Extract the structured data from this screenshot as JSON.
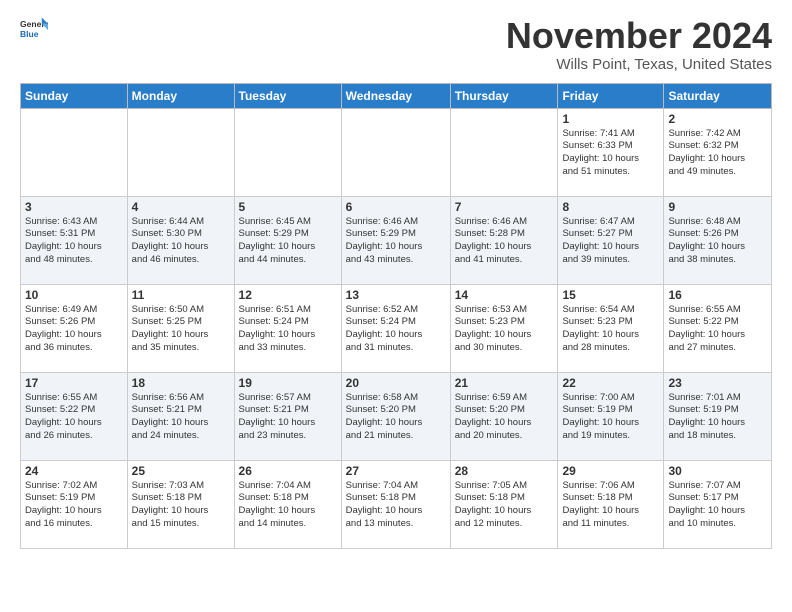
{
  "logo": {
    "general": "General",
    "blue": "Blue"
  },
  "header": {
    "month": "November 2024",
    "location": "Wills Point, Texas, United States"
  },
  "weekdays": [
    "Sunday",
    "Monday",
    "Tuesday",
    "Wednesday",
    "Thursday",
    "Friday",
    "Saturday"
  ],
  "weeks": [
    [
      {
        "day": "",
        "content": ""
      },
      {
        "day": "",
        "content": ""
      },
      {
        "day": "",
        "content": ""
      },
      {
        "day": "",
        "content": ""
      },
      {
        "day": "",
        "content": ""
      },
      {
        "day": "1",
        "content": "Sunrise: 7:41 AM\nSunset: 6:33 PM\nDaylight: 10 hours\nand 51 minutes."
      },
      {
        "day": "2",
        "content": "Sunrise: 7:42 AM\nSunset: 6:32 PM\nDaylight: 10 hours\nand 49 minutes."
      }
    ],
    [
      {
        "day": "3",
        "content": "Sunrise: 6:43 AM\nSunset: 5:31 PM\nDaylight: 10 hours\nand 48 minutes."
      },
      {
        "day": "4",
        "content": "Sunrise: 6:44 AM\nSunset: 5:30 PM\nDaylight: 10 hours\nand 46 minutes."
      },
      {
        "day": "5",
        "content": "Sunrise: 6:45 AM\nSunset: 5:29 PM\nDaylight: 10 hours\nand 44 minutes."
      },
      {
        "day": "6",
        "content": "Sunrise: 6:46 AM\nSunset: 5:29 PM\nDaylight: 10 hours\nand 43 minutes."
      },
      {
        "day": "7",
        "content": "Sunrise: 6:46 AM\nSunset: 5:28 PM\nDaylight: 10 hours\nand 41 minutes."
      },
      {
        "day": "8",
        "content": "Sunrise: 6:47 AM\nSunset: 5:27 PM\nDaylight: 10 hours\nand 39 minutes."
      },
      {
        "day": "9",
        "content": "Sunrise: 6:48 AM\nSunset: 5:26 PM\nDaylight: 10 hours\nand 38 minutes."
      }
    ],
    [
      {
        "day": "10",
        "content": "Sunrise: 6:49 AM\nSunset: 5:26 PM\nDaylight: 10 hours\nand 36 minutes."
      },
      {
        "day": "11",
        "content": "Sunrise: 6:50 AM\nSunset: 5:25 PM\nDaylight: 10 hours\nand 35 minutes."
      },
      {
        "day": "12",
        "content": "Sunrise: 6:51 AM\nSunset: 5:24 PM\nDaylight: 10 hours\nand 33 minutes."
      },
      {
        "day": "13",
        "content": "Sunrise: 6:52 AM\nSunset: 5:24 PM\nDaylight: 10 hours\nand 31 minutes."
      },
      {
        "day": "14",
        "content": "Sunrise: 6:53 AM\nSunset: 5:23 PM\nDaylight: 10 hours\nand 30 minutes."
      },
      {
        "day": "15",
        "content": "Sunrise: 6:54 AM\nSunset: 5:23 PM\nDaylight: 10 hours\nand 28 minutes."
      },
      {
        "day": "16",
        "content": "Sunrise: 6:55 AM\nSunset: 5:22 PM\nDaylight: 10 hours\nand 27 minutes."
      }
    ],
    [
      {
        "day": "17",
        "content": "Sunrise: 6:55 AM\nSunset: 5:22 PM\nDaylight: 10 hours\nand 26 minutes."
      },
      {
        "day": "18",
        "content": "Sunrise: 6:56 AM\nSunset: 5:21 PM\nDaylight: 10 hours\nand 24 minutes."
      },
      {
        "day": "19",
        "content": "Sunrise: 6:57 AM\nSunset: 5:21 PM\nDaylight: 10 hours\nand 23 minutes."
      },
      {
        "day": "20",
        "content": "Sunrise: 6:58 AM\nSunset: 5:20 PM\nDaylight: 10 hours\nand 21 minutes."
      },
      {
        "day": "21",
        "content": "Sunrise: 6:59 AM\nSunset: 5:20 PM\nDaylight: 10 hours\nand 20 minutes."
      },
      {
        "day": "22",
        "content": "Sunrise: 7:00 AM\nSunset: 5:19 PM\nDaylight: 10 hours\nand 19 minutes."
      },
      {
        "day": "23",
        "content": "Sunrise: 7:01 AM\nSunset: 5:19 PM\nDaylight: 10 hours\nand 18 minutes."
      }
    ],
    [
      {
        "day": "24",
        "content": "Sunrise: 7:02 AM\nSunset: 5:19 PM\nDaylight: 10 hours\nand 16 minutes."
      },
      {
        "day": "25",
        "content": "Sunrise: 7:03 AM\nSunset: 5:18 PM\nDaylight: 10 hours\nand 15 minutes."
      },
      {
        "day": "26",
        "content": "Sunrise: 7:04 AM\nSunset: 5:18 PM\nDaylight: 10 hours\nand 14 minutes."
      },
      {
        "day": "27",
        "content": "Sunrise: 7:04 AM\nSunset: 5:18 PM\nDaylight: 10 hours\nand 13 minutes."
      },
      {
        "day": "28",
        "content": "Sunrise: 7:05 AM\nSunset: 5:18 PM\nDaylight: 10 hours\nand 12 minutes."
      },
      {
        "day": "29",
        "content": "Sunrise: 7:06 AM\nSunset: 5:18 PM\nDaylight: 10 hours\nand 11 minutes."
      },
      {
        "day": "30",
        "content": "Sunrise: 7:07 AM\nSunset: 5:17 PM\nDaylight: 10 hours\nand 10 minutes."
      }
    ]
  ]
}
